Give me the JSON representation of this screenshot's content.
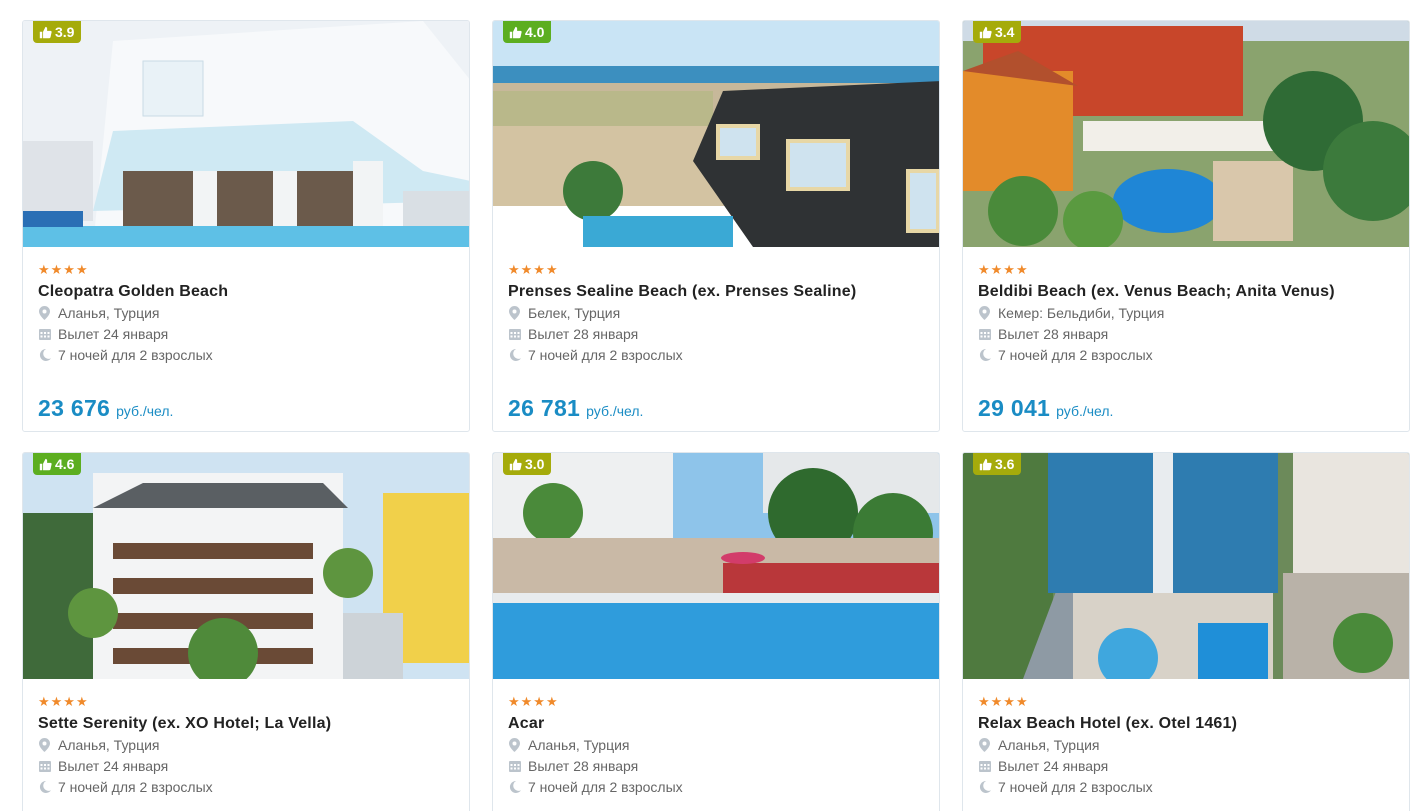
{
  "hotels": [
    {
      "rating": "3.9",
      "stars": "★★★★",
      "name": "Cleopatra Golden Beach",
      "location": "Аланья, Турция",
      "departure": "Вылет 24 января",
      "nights": "7 ночей для 2 взрослых",
      "price": "23 676",
      "price_unit": "руб./чел."
    },
    {
      "rating": "4.0",
      "stars": "★★★★",
      "name": "Prenses Sealine Beach (ex. Prenses Sealine)",
      "location": "Белек, Турция",
      "departure": "Вылет 28 января",
      "nights": "7 ночей для 2 взрослых",
      "price": "26 781",
      "price_unit": "руб./чел."
    },
    {
      "rating": "3.4",
      "stars": "★★★★",
      "name": "Beldibi Beach (ex. Venus Beach; Anita Venus)",
      "location": "Кемер: Бельдиби, Турция",
      "departure": "Вылет 28 января",
      "nights": "7 ночей для 2 взрослых",
      "price": "29 041",
      "price_unit": "руб./чел."
    },
    {
      "rating": "4.6",
      "stars": "★★★★",
      "name": "Sette Serenity (ex. XO Hotel; La Vella)",
      "location": "Аланья, Турция",
      "departure": "Вылет 24 января",
      "nights": "7 ночей для 2 взрослых"
    },
    {
      "rating": "3.0",
      "stars": "★★★★",
      "name": "Acar",
      "location": "Аланья, Турция",
      "departure": "Вылет 28 января",
      "nights": "7 ночей для 2 взрослых"
    },
    {
      "rating": "3.6",
      "stars": "★★★★",
      "name": "Relax Beach Hotel (ex. Otel 1461)",
      "location": "Аланья, Турция",
      "departure": "Вылет 24 января",
      "nights": "7 ночей для 2 взрослых"
    }
  ],
  "colors": {
    "badge_olive": "#a5ab0b",
    "badge_green": "#5cae20",
    "price_blue": "#1a8cc4",
    "star_orange": "#f08a2b"
  },
  "icons": [
    "thumbs-up-icon",
    "location-pin-icon",
    "calendar-icon",
    "moon-icon"
  ]
}
